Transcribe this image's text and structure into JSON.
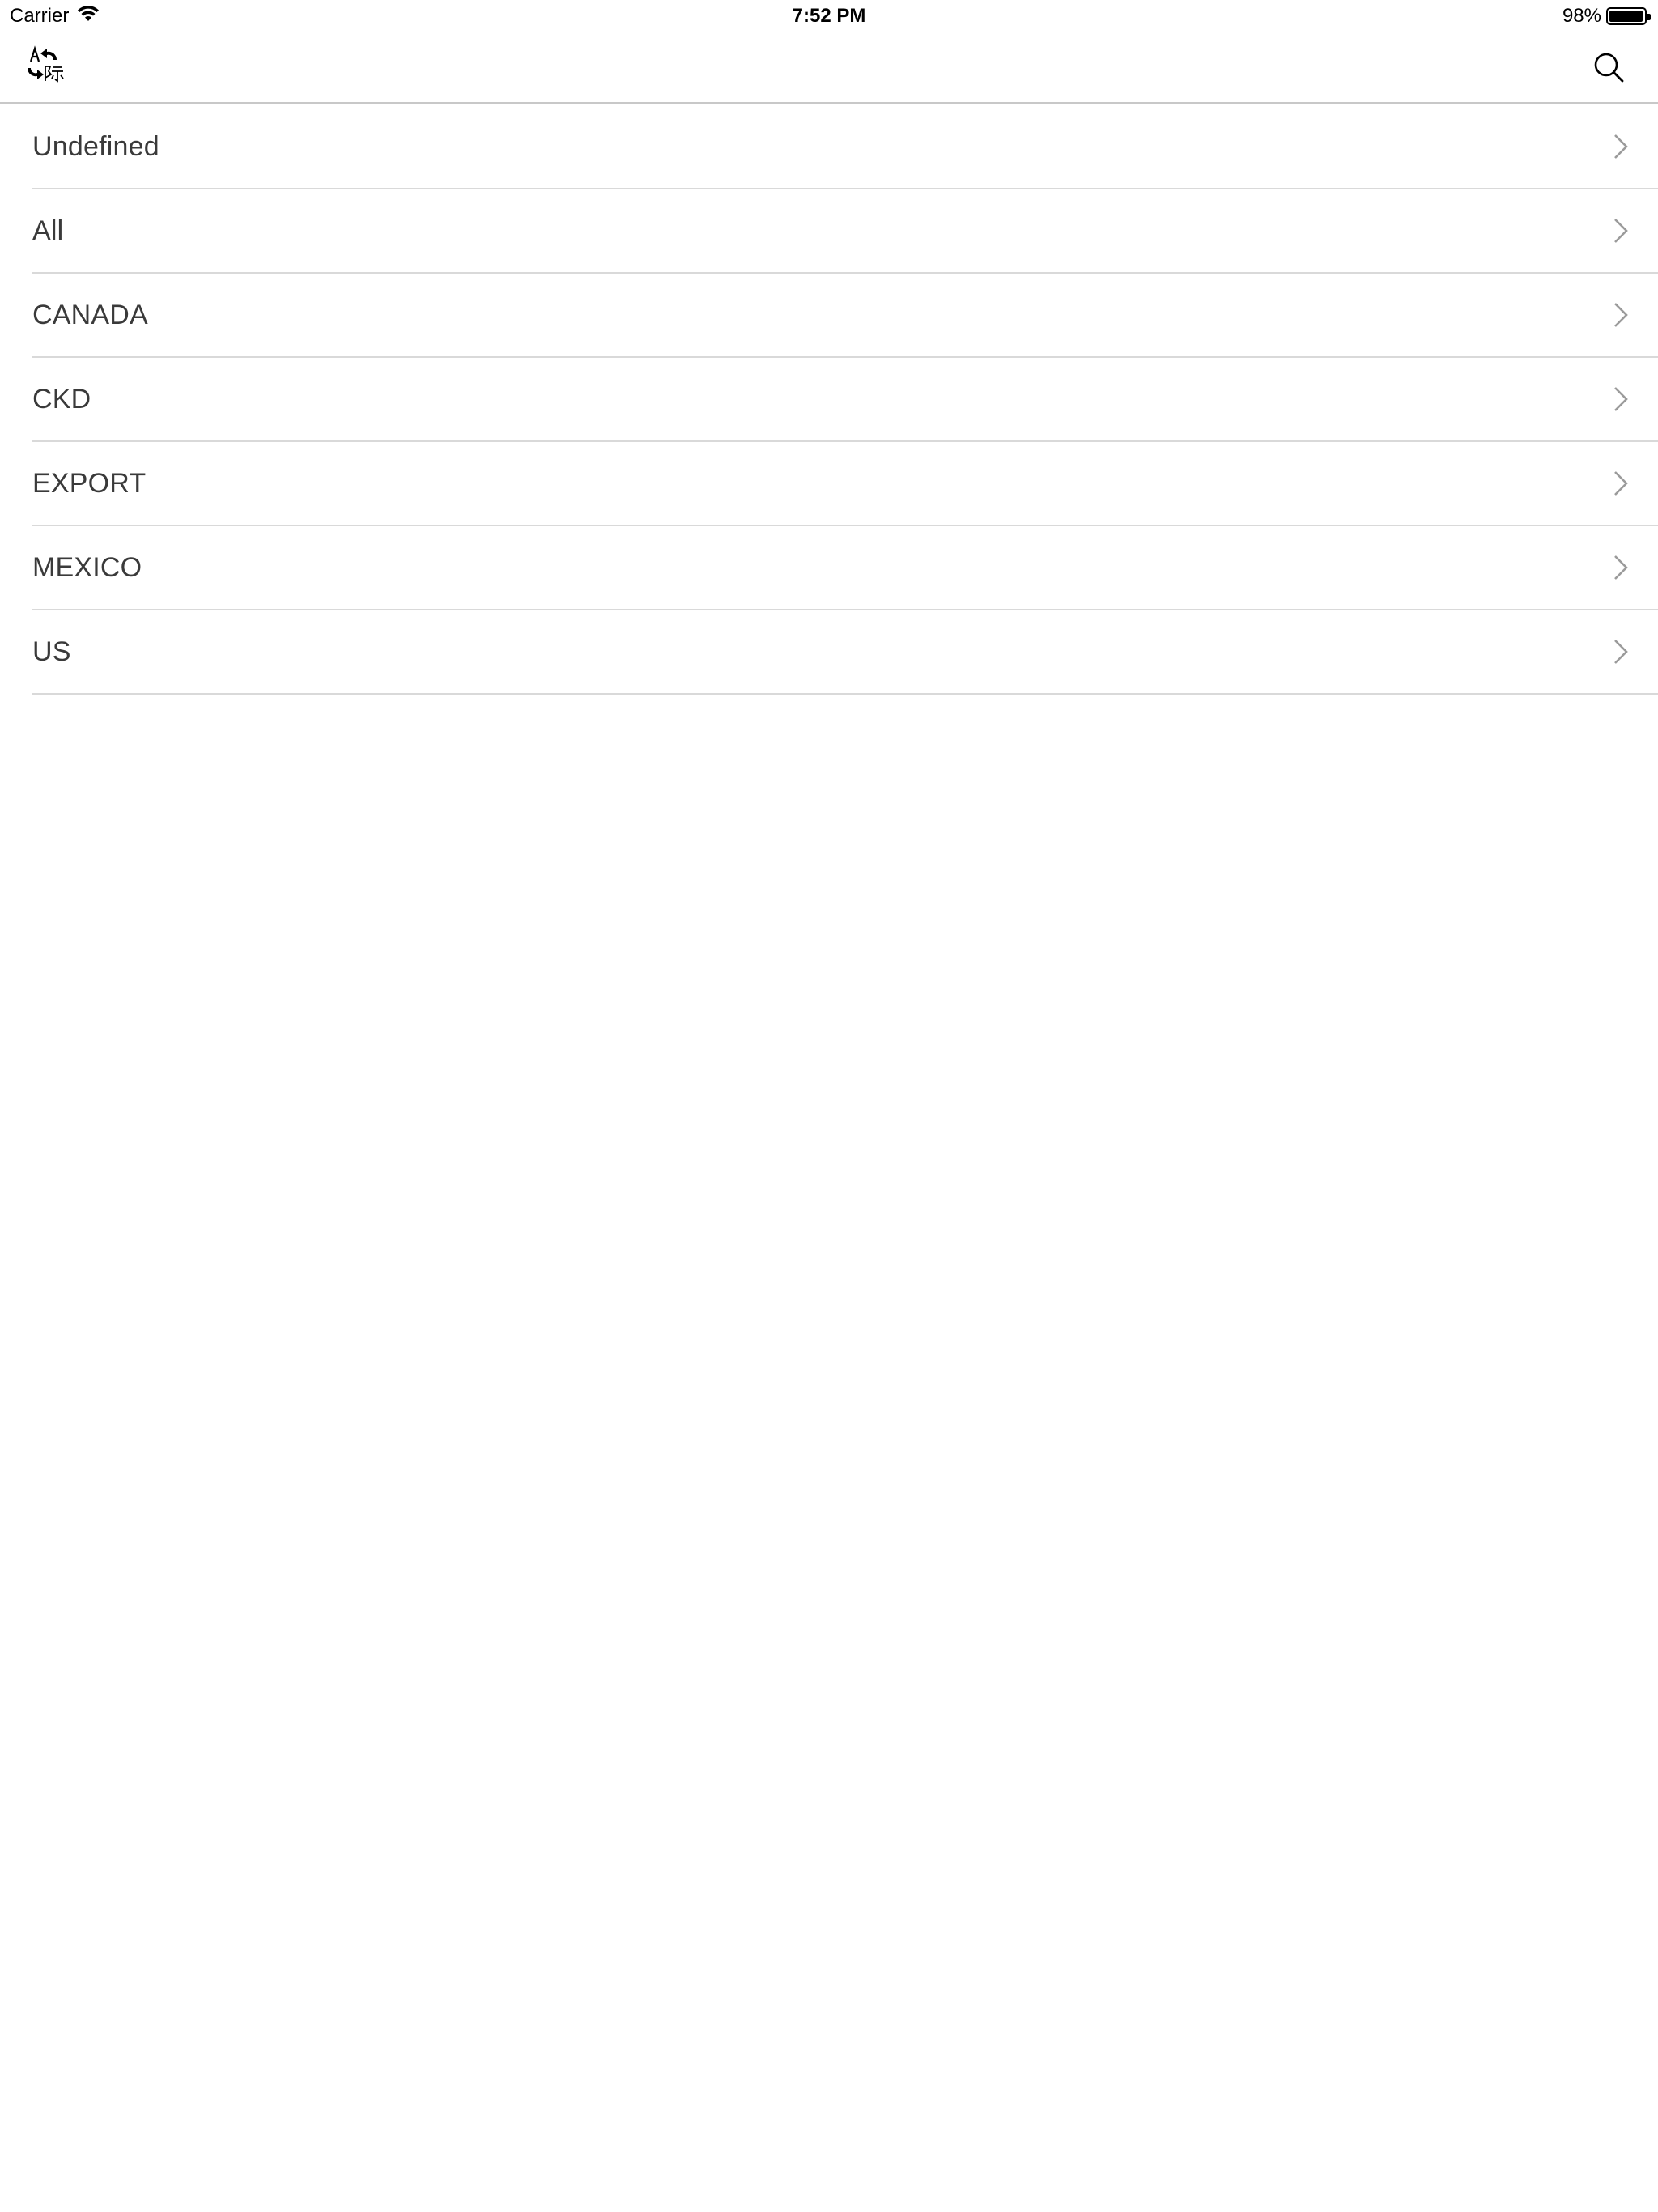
{
  "status_bar": {
    "carrier": "Carrier",
    "time": "7:52 PM",
    "battery_percent": "98%",
    "battery_level": 0.98
  },
  "nav_bar": {
    "left_icon": "translate-icon",
    "right_icon": "search-icon"
  },
  "list": {
    "items": [
      {
        "label": "Undefined"
      },
      {
        "label": "All"
      },
      {
        "label": "CANADA"
      },
      {
        "label": "CKD"
      },
      {
        "label": "EXPORT"
      },
      {
        "label": "MEXICO"
      },
      {
        "label": "US"
      }
    ]
  },
  "colors": {
    "separator": "#d9d9d9",
    "chevron": "#9b9b9b",
    "text": "#3a3a3a"
  }
}
